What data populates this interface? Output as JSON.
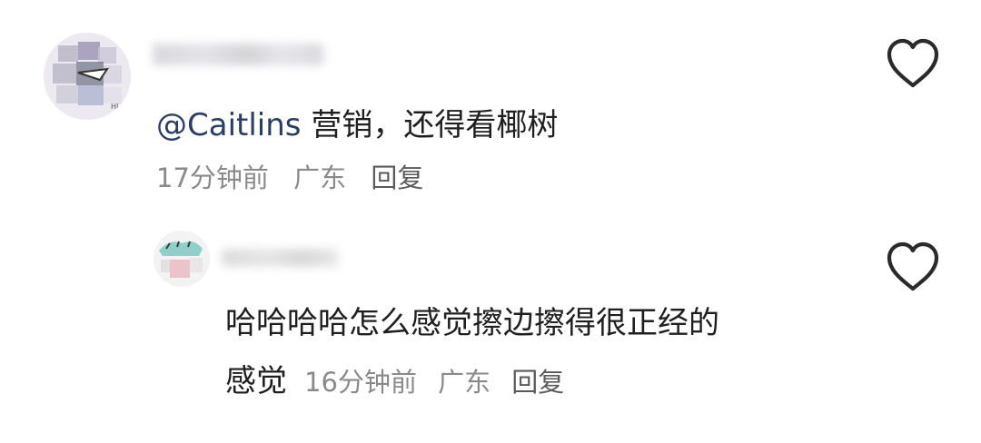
{
  "comments": [
    {
      "mention": "@Caitlins",
      "text": "营销，还得看椰树",
      "time": "17分钟前",
      "location": "广东",
      "reply_label": "回复"
    },
    {
      "text_line1": "哈哈哈哈怎么感觉擦边擦得很正经的",
      "text_line2": "感觉",
      "time": "16分钟前",
      "location": "广东",
      "reply_label": "回复"
    }
  ],
  "icons": {
    "like": "heart-outline-icon"
  },
  "colors": {
    "mention": "#2b3d63",
    "meta": "#8a8a8a",
    "text": "#1f1f1f"
  }
}
